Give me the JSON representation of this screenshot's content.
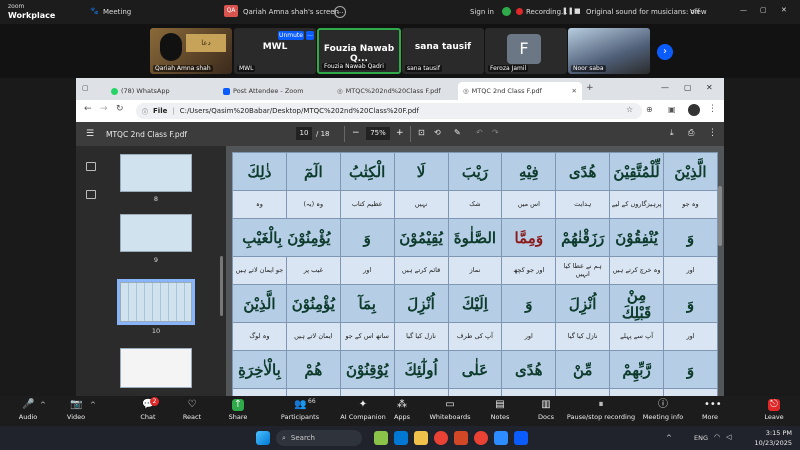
{
  "zoom": {
    "logo": [
      "zoom",
      "Workplace"
    ],
    "meeting_label": "Meeting",
    "share_title": "Qariah Amna shah's screen",
    "share_badge": "QA",
    "sign_in": "Sign in",
    "recording": "Recording...",
    "original_sound": "Original sound for musicians: off",
    "view": "View"
  },
  "participants": [
    {
      "name": "Qariah Amna shah",
      "type": "video"
    },
    {
      "name": "MWL",
      "big": "MWL",
      "type": "text"
    },
    {
      "name": "Fouzia Nawab Qadri",
      "big": "Fouzia Nawab Q...",
      "type": "active"
    },
    {
      "name": "sana tausif",
      "big": "sana tausif",
      "type": "text"
    },
    {
      "name": "Feroza Jamil",
      "big": "F",
      "type": "avatar"
    },
    {
      "name": "Noor saba",
      "type": "video2"
    }
  ],
  "unmute_label": "Unmute",
  "browser": {
    "tabs": [
      {
        "label": "(78) WhatsApp"
      },
      {
        "label": "Post Attendee - Zoom"
      },
      {
        "label": "MTQC%202nd%20Class F.pdf"
      },
      {
        "label": "MTQC 2nd Class F.pdf"
      }
    ],
    "url_prefix": "File",
    "url": "C:/Users/Qasim%20Babar/Desktop/MTQC%202nd%20Class%20F.pdf"
  },
  "pdf": {
    "title": "MTQC 2nd Class F.pdf",
    "page_current": "10",
    "page_total": "/  18",
    "zoom": "75%",
    "thumbnails": [
      {
        "label": "8"
      },
      {
        "label": "9"
      },
      {
        "label": "10"
      }
    ]
  },
  "grid": [
    {
      "arabic": [
        "ذٰلِكَ",
        "الٓمٓ",
        "الْكِتٰبُ",
        "لَا",
        "رَيْبَ",
        "فِيْهِ",
        "هُدًى",
        "لِّلْمُتَّقِيْنَ",
        "الَّذِيْنَ"
      ],
      "urdu": [
        "وہ",
        "(یہ) وہ",
        "عظیم کتاب",
        "نہیں",
        "شک",
        "اس میں",
        "ہدایت",
        "پرہیزگاروں کے لیے",
        "وہ جو"
      ]
    },
    {
      "arabic": [
        "يُؤْمِنُوْنَ بِالْغَيْبِ",
        "وَ",
        "يُقِيْمُوْنَ",
        "الصَّلٰوةَ",
        "وَمِمَّا",
        "رَزَقْنٰهُمْ",
        "يُنْفِقُوْنَ",
        "وَ"
      ],
      "urdu": [
        "جو ایمان لاتے ہیں",
        "غیب پر",
        "اور",
        "قائم کرتے ہیں",
        "نماز",
        "اور جو کچھ",
        "ہم نے عطا کیا انہیں",
        "وہ خرچ کرتے ہیں",
        "اور"
      ]
    },
    {
      "arabic": [
        "الَّذِيْنَ",
        "يُؤْمِنُوْنَ",
        "بِمَآ",
        "اُنْزِلَ",
        "اِلَيْكَ",
        "وَ",
        "اُنْزِلَ",
        "مِنْ قَبْلِكَ",
        "وَ"
      ],
      "urdu": [
        "وہ لوگ",
        "ایمان لاتے ہیں",
        "ساتھ اس کے جو",
        "نازل کیا گیا",
        "آپ کی طرف",
        "اور",
        "نازل کیا گیا",
        "آپ سے پہلے",
        "اور"
      ]
    },
    {
      "arabic": [
        "بِالْاٰخِرَةِ",
        "هُمْ",
        "يُوْقِنُوْنَ",
        "اُولٰٓئِكَ",
        "عَلٰى",
        "هُدًى",
        "مِّنْ",
        "رَّبِّهِمْ",
        "وَ"
      ],
      "urdu": [
        "",
        "",
        "",
        "",
        "",
        "",
        "",
        "",
        ""
      ]
    }
  ],
  "toolbar": {
    "audio": "Audio",
    "video": "Video",
    "chat": "Chat",
    "chat_badge": "2",
    "react": "React",
    "share": "Share",
    "participants": "Participants",
    "participants_count": "66",
    "ai_companion": "AI Companion",
    "apps": "Apps",
    "whiteboards": "Whiteboards",
    "notes": "Notes",
    "docs": "Docs",
    "pause_recording": "Pause/stop recording",
    "meeting_info": "Meeting info",
    "more": "More",
    "leave": "Leave"
  },
  "taskbar": {
    "search": "Search",
    "lang": "ENG",
    "time": "3:15 PM",
    "date": "10/23/2025"
  },
  "colors": {
    "zoom_blue": "#0b5cff",
    "leave_red": "#e02828",
    "pdf_cell": "#b6cde6",
    "pdf_cell_text": "#0d3b2c"
  }
}
